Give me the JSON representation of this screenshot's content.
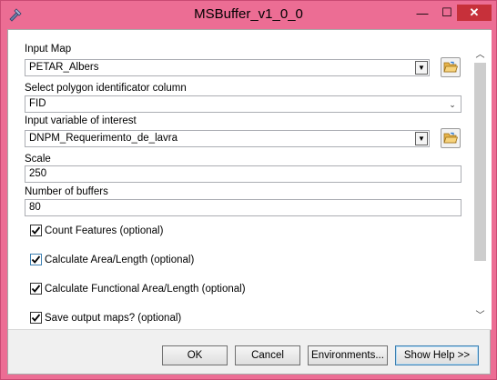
{
  "window": {
    "title": "MSBuffer_v1_0_0",
    "minimize": "—",
    "maximize": "☐",
    "close": "✕"
  },
  "form": {
    "input_map": {
      "label": "Input Map",
      "value": "PETAR_Albers",
      "dropdown_icon": "chevron-down-icon",
      "browse_icon": "folder-open-icon"
    },
    "id_column": {
      "label": "Select polygon identificator column",
      "value": "FID",
      "dropdown_icon": "chevron-down-icon"
    },
    "variable": {
      "label": "Input variable of interest",
      "value": "DNPM_Requerimento_de_lavra",
      "dropdown_icon": "chevron-down-icon",
      "browse_icon": "folder-open-icon"
    },
    "scale": {
      "label": "Scale",
      "value": "250"
    },
    "num_buffers": {
      "label": "Number of buffers",
      "value": "80"
    },
    "checkboxes": [
      {
        "label": "Count Features (optional)",
        "checked": true
      },
      {
        "label": "Calculate Area/Length (optional)",
        "checked": true
      },
      {
        "label": "Calculate Functional Area/Length (optional)",
        "checked": true
      },
      {
        "label": "Save output maps? (optional)",
        "checked": true
      }
    ]
  },
  "buttons": {
    "ok": "OK",
    "cancel": "Cancel",
    "environments": "Environments...",
    "help": "Show Help >>"
  },
  "colors": {
    "titlebar": "#ec6d94",
    "close": "#c7303a",
    "folder": "#e6b34a"
  }
}
